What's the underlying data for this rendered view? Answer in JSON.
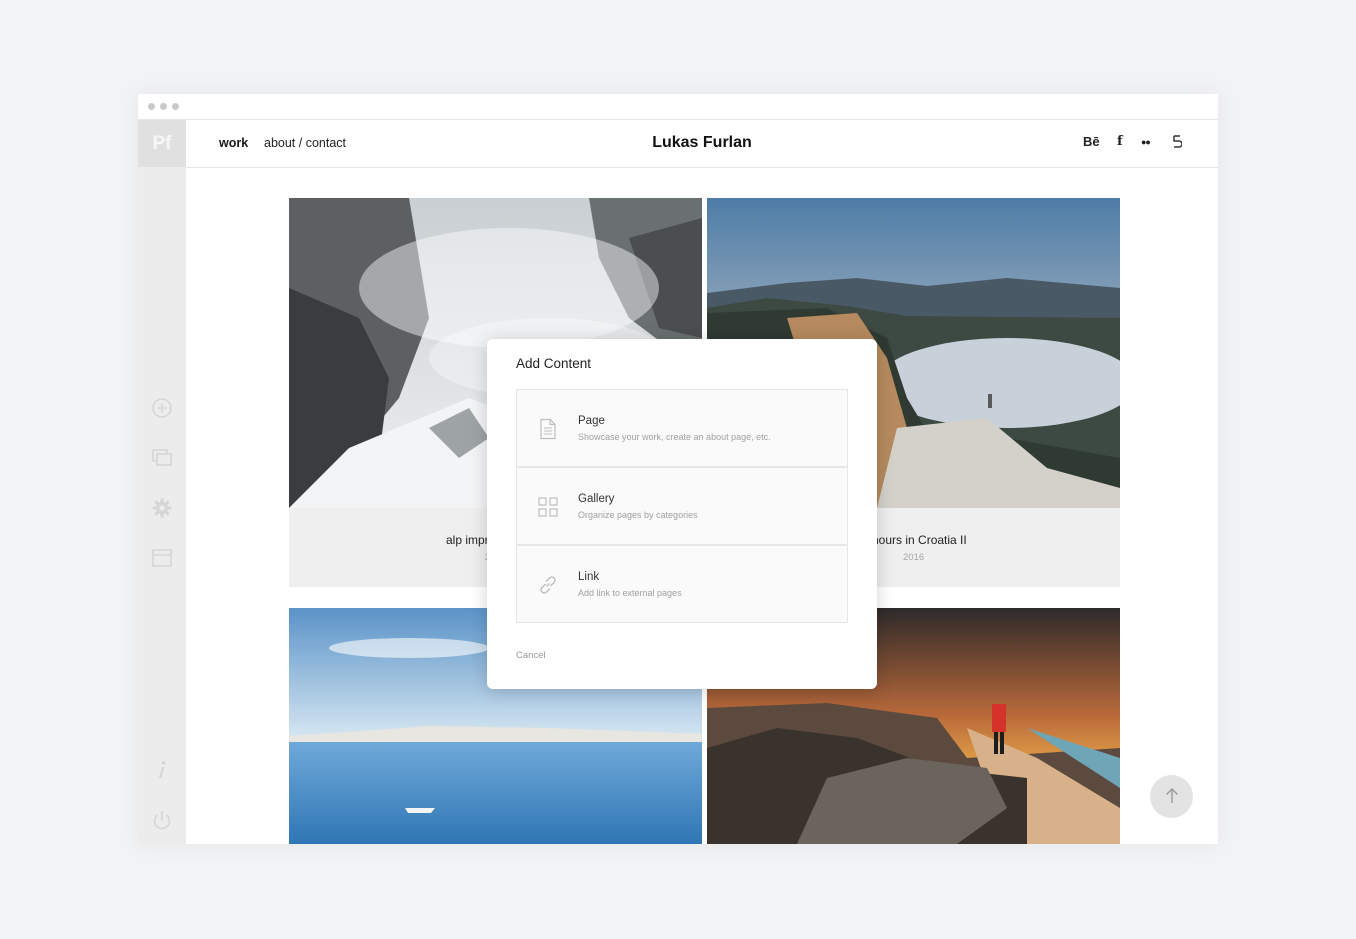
{
  "sidebar": {
    "logo": "Pf"
  },
  "nav": {
    "work": "work",
    "about_contact": "about / contact"
  },
  "site": {
    "title": "Lukas Furlan"
  },
  "social": {
    "behance": "Bē",
    "facebook": "f",
    "flickr": "●●",
    "other": "500px-icon"
  },
  "gallery": {
    "tiles": [
      {
        "title": "alp impr",
        "year": "2"
      },
      {
        "title": "hours in Croatia II",
        "year": "2016"
      },
      {
        "title": "",
        "year": ""
      },
      {
        "title": "",
        "year": ""
      }
    ]
  },
  "modal": {
    "title": "Add Content",
    "options": [
      {
        "label": "Page",
        "description": "Showcase your work, create an about page, etc.",
        "icon": "page-icon"
      },
      {
        "label": "Gallery",
        "description": "Organize pages by categories",
        "icon": "grid-icon"
      },
      {
        "label": "Link",
        "description": "Add link to external pages",
        "icon": "link-icon"
      }
    ],
    "cancel": "Cancel"
  },
  "colors": {
    "sidebar": "#ececec",
    "modal_bg": "#ffffff",
    "page_bg": "#f2f3f5"
  }
}
